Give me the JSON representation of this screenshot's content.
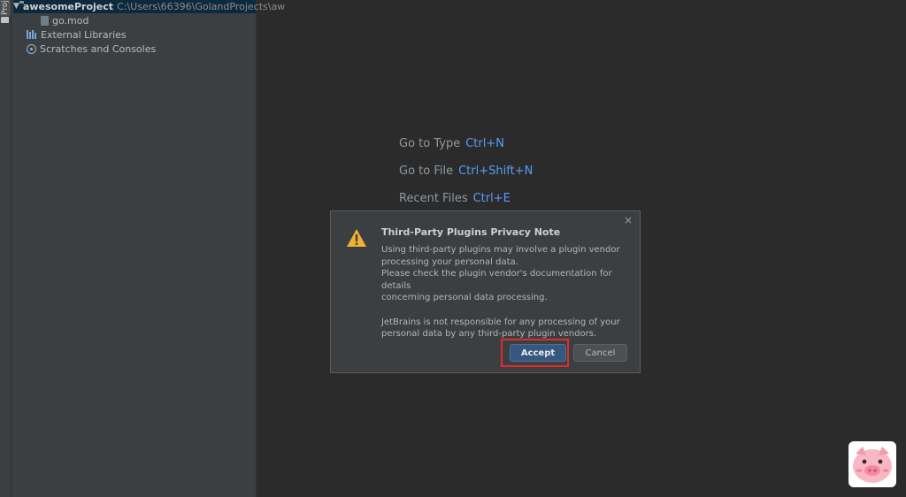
{
  "sidebar": {
    "tool_tab": "Proj",
    "tree": [
      {
        "label": "awesomeProject",
        "path": "C:\\Users\\66396\\GolandProjects\\aw"
      },
      {
        "label": "go.mod"
      },
      {
        "label": "External Libraries"
      },
      {
        "label": "Scratches and Consoles"
      }
    ]
  },
  "editor": {
    "hints": [
      {
        "label": "Go to Type",
        "shortcut": "Ctrl+N"
      },
      {
        "label": "Go to File",
        "shortcut": "Ctrl+Shift+N"
      },
      {
        "label": "Recent Files",
        "shortcut": "Ctrl+E"
      }
    ]
  },
  "dialog": {
    "title": "Third-Party Plugins Privacy Note",
    "lines": [
      "Using third-party plugins may involve a plugin vendor",
      "processing your personal data.",
      "Please check the plugin vendor's documentation for details",
      "concerning personal data processing.",
      "JetBrains is not responsible for any processing of your",
      "personal data by any third-party plugin vendors."
    ],
    "accept_label": "Accept",
    "cancel_label": "Cancel",
    "close_glyph": "×"
  },
  "colors": {
    "accent": "#365880",
    "highlight": "#e22b2b",
    "warning": "#f2b134"
  }
}
